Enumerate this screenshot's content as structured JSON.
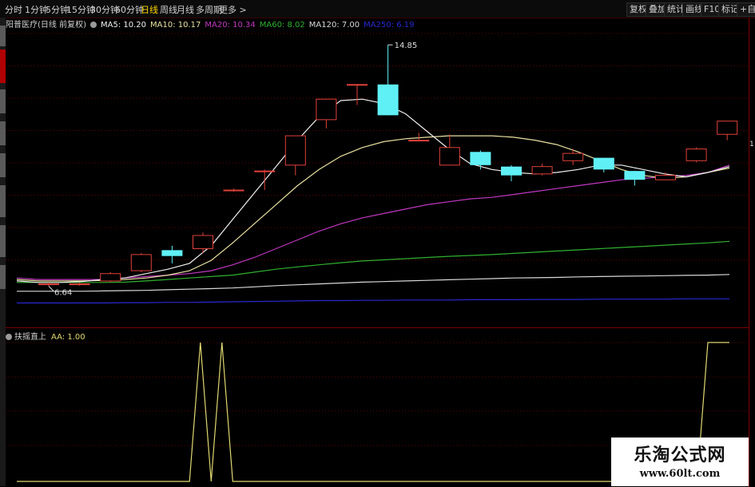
{
  "toolbar": {
    "periods": [
      "分时",
      "1分钟",
      "5分钟",
      "15分钟",
      "30分钟",
      "60分钟",
      "日线",
      "周线",
      "月线",
      "多周期",
      "更多 >"
    ],
    "active_period": "日线",
    "right_buttons": [
      "复权",
      "叠加",
      "统计",
      "画线",
      "F10",
      "标记",
      "+自选"
    ]
  },
  "legend": {
    "title": "阳普医疗(日线 前复权)",
    "ma5": "MA5: 10.20",
    "ma10": "MA10: 10.17",
    "ma20": "MA20: 10.34",
    "ma60": "MA60: 8.02",
    "ma120": "MA120: 7.00",
    "ma250": "MA250: 6.19"
  },
  "colors": {
    "up": "#e0413a",
    "down": "#5ff0f5",
    "ma5": "#f0f0f0",
    "ma10": "#e8e0a0",
    "ma20": "#c038c0",
    "ma60": "#30b030",
    "ma120": "#d8d8d8",
    "ma250": "#2828d0",
    "indicator": "#e0d870",
    "grid": "#5a0000"
  },
  "price_chart": {
    "high_label": "14.85",
    "low_label": "6.64",
    "candles": [
      {
        "o": 6.7,
        "c": 6.7,
        "h": 6.75,
        "l": 6.62
      },
      {
        "o": 6.7,
        "c": 6.7,
        "h": 6.75,
        "l": 6.64
      },
      {
        "o": 6.8,
        "c": 7.05,
        "h": 7.1,
        "l": 6.75
      },
      {
        "o": 7.15,
        "c": 7.7,
        "h": 7.75,
        "l": 7.1
      },
      {
        "o": 7.85,
        "c": 7.65,
        "h": 8.0,
        "l": 7.4
      },
      {
        "o": 7.9,
        "c": 8.35,
        "h": 8.45,
        "l": 7.75
      },
      {
        "o": 9.9,
        "c": 9.9,
        "h": 9.95,
        "l": 9.85
      },
      {
        "o": 10.55,
        "c": 10.55,
        "h": 10.6,
        "l": 9.9
      },
      {
        "o": 10.75,
        "c": 11.75,
        "h": 11.75,
        "l": 10.4
      },
      {
        "o": 12.3,
        "c": 13.0,
        "h": 13.0,
        "l": 12.0
      },
      {
        "o": 13.5,
        "c": 13.5,
        "h": 13.5,
        "l": 12.8
      },
      {
        "o": 13.5,
        "c": 12.45,
        "h": 14.85,
        "l": 12.45
      },
      {
        "o": 11.6,
        "c": 11.6,
        "h": 11.85,
        "l": 11.6
      },
      {
        "o": 10.75,
        "c": 11.35,
        "h": 11.8,
        "l": 10.75
      },
      {
        "o": 11.2,
        "c": 10.75,
        "h": 11.25,
        "l": 10.6
      },
      {
        "o": 10.7,
        "c": 10.4,
        "h": 10.75,
        "l": 10.2
      },
      {
        "o": 10.45,
        "c": 10.7,
        "h": 10.8,
        "l": 10.4
      },
      {
        "o": 10.9,
        "c": 11.15,
        "h": 11.3,
        "l": 10.75
      },
      {
        "o": 11.0,
        "c": 10.6,
        "h": 11.0,
        "l": 10.5
      },
      {
        "o": 10.55,
        "c": 10.25,
        "h": 10.55,
        "l": 10.05
      },
      {
        "o": 10.25,
        "c": 10.4,
        "h": 10.5,
        "l": 10.25
      },
      {
        "o": 10.9,
        "c": 11.3,
        "h": 11.35,
        "l": 10.85
      },
      {
        "o": 11.8,
        "c": 12.25,
        "h": 12.25,
        "l": 11.6
      }
    ],
    "ma5": [
      6.8,
      6.75,
      6.75,
      6.78,
      6.85,
      6.9,
      7.05,
      7.2,
      7.4,
      8.0,
      8.9,
      9.8,
      10.7,
      11.6,
      12.4,
      12.95,
      13.0,
      12.85,
      12.5,
      11.9,
      11.3,
      10.8,
      10.6,
      10.5,
      10.45,
      10.5,
      10.6,
      10.75,
      10.75,
      10.6,
      10.45,
      10.35,
      10.5,
      10.7
    ],
    "ma10": [
      6.85,
      6.8,
      6.8,
      6.8,
      6.82,
      6.85,
      6.9,
      7.0,
      7.15,
      7.5,
      8.1,
      8.75,
      9.4,
      10.05,
      10.6,
      11.05,
      11.35,
      11.55,
      11.65,
      11.7,
      11.75,
      11.75,
      11.75,
      11.7,
      11.6,
      11.45,
      11.2,
      10.9,
      10.6,
      10.4,
      10.3,
      10.35,
      10.5,
      10.65
    ],
    "ma20": [
      6.9,
      6.85,
      6.85,
      6.85,
      6.85,
      6.9,
      6.95,
      7.0,
      7.05,
      7.15,
      7.35,
      7.6,
      7.9,
      8.2,
      8.5,
      8.75,
      8.95,
      9.1,
      9.25,
      9.4,
      9.5,
      9.6,
      9.65,
      9.75,
      9.85,
      9.95,
      10.05,
      10.15,
      10.25,
      10.3,
      10.35,
      10.4,
      10.5,
      10.75
    ],
    "ma60": [
      6.75,
      6.75,
      6.75,
      6.75,
      6.75,
      6.76,
      6.8,
      6.85,
      6.9,
      6.95,
      7.0,
      7.1,
      7.2,
      7.28,
      7.35,
      7.42,
      7.48,
      7.52,
      7.56,
      7.6,
      7.64,
      7.67,
      7.7,
      7.74,
      7.78,
      7.82,
      7.86,
      7.9,
      7.94,
      7.98,
      8.02,
      8.06,
      8.1,
      8.15
    ],
    "ma120": [
      6.45,
      6.45,
      6.45,
      6.45,
      6.46,
      6.47,
      6.48,
      6.5,
      6.52,
      6.54,
      6.56,
      6.6,
      6.64,
      6.67,
      6.7,
      6.73,
      6.76,
      6.78,
      6.8,
      6.82,
      6.84,
      6.86,
      6.88,
      6.9,
      6.91,
      6.92,
      6.94,
      6.95,
      6.96,
      6.97,
      6.98,
      6.99,
      7.0,
      7.02
    ],
    "ma250": [
      6.05,
      6.05,
      6.05,
      6.05,
      6.05,
      6.06,
      6.06,
      6.07,
      6.07,
      6.08,
      6.09,
      6.1,
      6.11,
      6.12,
      6.13,
      6.13,
      6.14,
      6.14,
      6.15,
      6.15,
      6.15,
      6.16,
      6.16,
      6.16,
      6.17,
      6.17,
      6.17,
      6.18,
      6.18,
      6.18,
      6.18,
      6.19,
      6.19,
      6.19
    ]
  },
  "indicator": {
    "name": "扶摇直上",
    "value": "AA: 1.00",
    "values": [
      0,
      0,
      0,
      0,
      0,
      0,
      0,
      0,
      0,
      0,
      0,
      0,
      0,
      0,
      0,
      0,
      0,
      1,
      0,
      1,
      0,
      0,
      0,
      0,
      0,
      0,
      0,
      0,
      0,
      0,
      0,
      0,
      0,
      0,
      0,
      0,
      0,
      0,
      0,
      0,
      0,
      0,
      0,
      0,
      0,
      0,
      0,
      0,
      0,
      0,
      0,
      0,
      0,
      0,
      0,
      0,
      0,
      0,
      0,
      0,
      0,
      0,
      0,
      0,
      1,
      1,
      1
    ]
  },
  "right_tag": "1",
  "watermark": {
    "title": "乐淘公式网",
    "url": "www.60lt.com"
  }
}
